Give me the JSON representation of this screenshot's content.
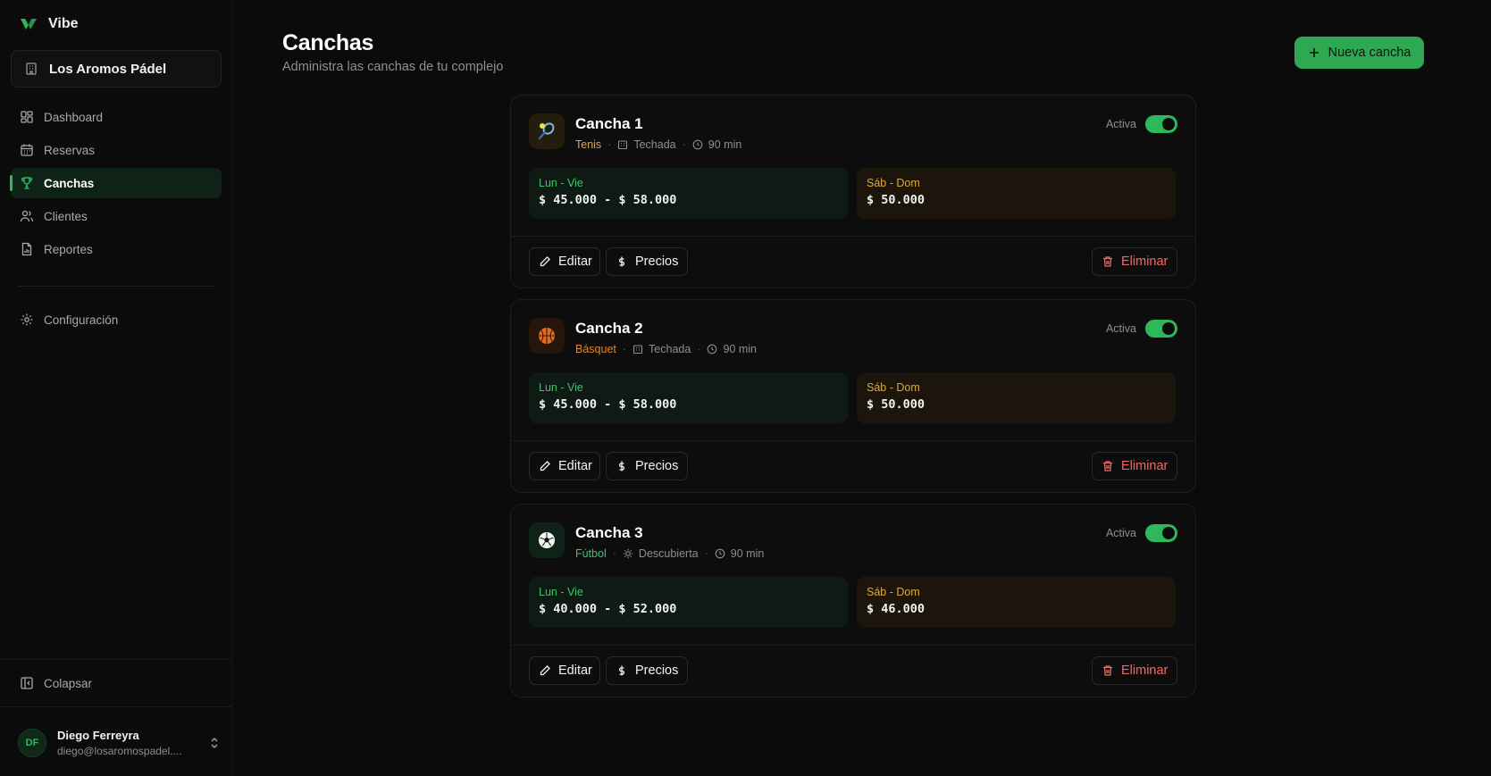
{
  "app": {
    "name": "Vibe"
  },
  "organization": {
    "name": "Los Aromos Pádel"
  },
  "nav": {
    "items": [
      {
        "label": "Dashboard",
        "icon": "dashboard-icon"
      },
      {
        "label": "Reservas",
        "icon": "calendar-icon"
      },
      {
        "label": "Canchas",
        "icon": "trophy-icon",
        "active": true
      },
      {
        "label": "Clientes",
        "icon": "users-icon"
      },
      {
        "label": "Reportes",
        "icon": "report-icon"
      }
    ],
    "settings": "Configuración",
    "collapse": "Colapsar"
  },
  "user": {
    "initials": "DF",
    "name": "Diego Ferreyra",
    "email": "diego@losaromospadel...."
  },
  "header": {
    "title": "Canchas",
    "subtitle": "Administra las canchas de tu complejo",
    "new_button": "Nueva cancha"
  },
  "courts": [
    {
      "name": "Cancha 1",
      "sport": "Tenis",
      "sport_color": "#e1a93a",
      "type": "Techada",
      "duration": "90 min",
      "status": "Activa",
      "icon": "tennis-racket-icon",
      "weekday_label": "Lun - Vie",
      "weekday_price": "$ 45.000 - $ 58.000",
      "weekend_label": "Sáb - Dom",
      "weekend_price": "$ 50.000"
    },
    {
      "name": "Cancha 2",
      "sport": "Básquet",
      "sport_color": "#e8852c",
      "type": "Techada",
      "duration": "90 min",
      "status": "Activa",
      "icon": "basketball-icon",
      "weekday_label": "Lun - Vie",
      "weekday_price": "$ 45.000 - $ 58.000",
      "weekend_label": "Sáb - Dom",
      "weekend_price": "$ 50.000"
    },
    {
      "name": "Cancha 3",
      "sport": "Fútbol",
      "sport_color": "#3fc46b",
      "type": "Descubierta",
      "duration": "90 min",
      "status": "Activa",
      "icon": "soccer-ball-icon",
      "weekday_label": "Lun - Vie",
      "weekday_price": "$ 40.000 - $ 52.000",
      "weekend_label": "Sáb - Dom",
      "weekend_price": "$ 46.000"
    }
  ],
  "actions": {
    "edit": "Editar",
    "prices": "Precios",
    "delete": "Eliminar"
  },
  "colors": {
    "accent": "#2eb85c",
    "danger": "#f06a6a",
    "weekday": "#3fc46b",
    "weekend": "#e1a93a"
  }
}
